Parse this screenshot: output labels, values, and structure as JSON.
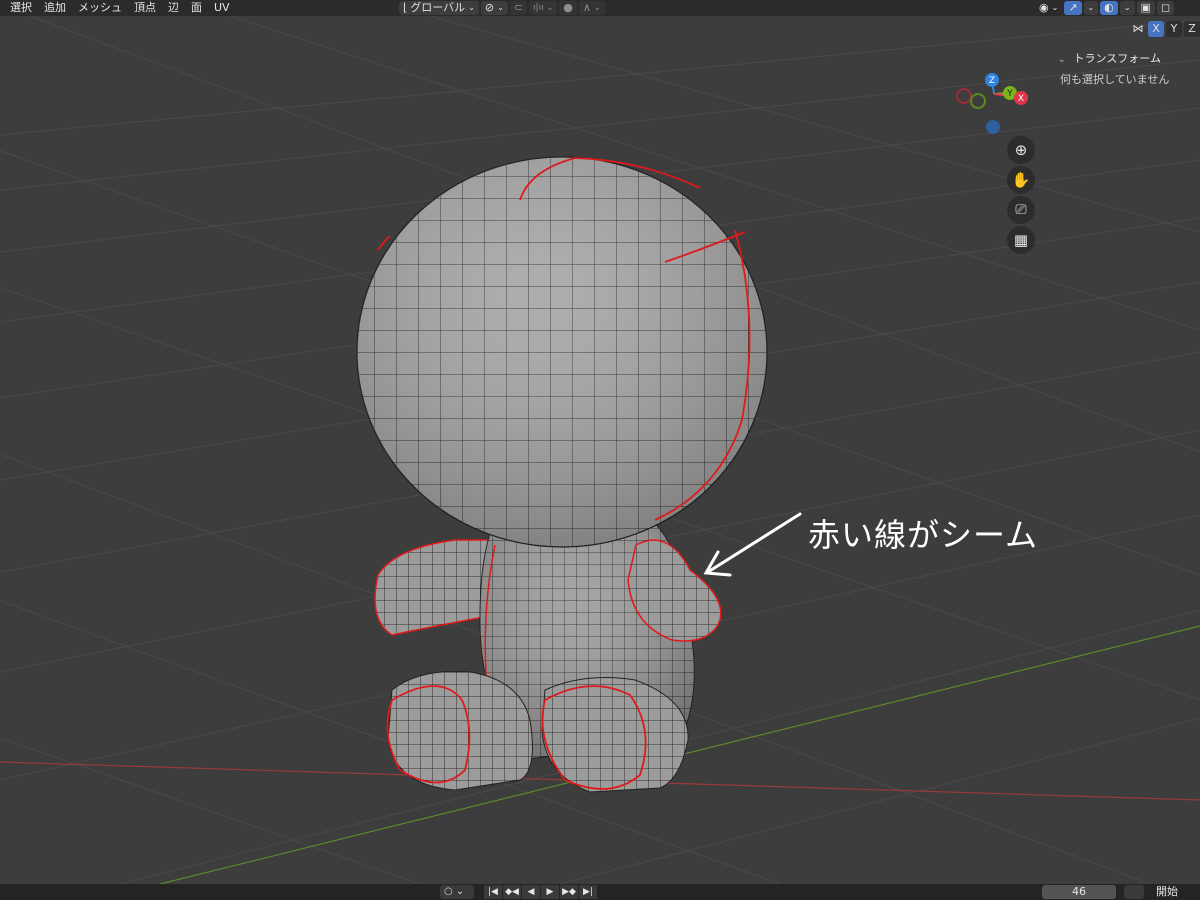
{
  "menu": {
    "items": [
      "選択",
      "追加",
      "メッシュ",
      "頂点",
      "辺",
      "面",
      "UV"
    ]
  },
  "toolbar": {
    "transform_orientation": "グローバル",
    "snap_increment_label": "ı|ıı"
  },
  "axis_toggles": [
    "X",
    "Y",
    "Z"
  ],
  "n_panel": {
    "section_title": "トランスフォーム",
    "empty_message": "何も選択していません"
  },
  "gizmo": {
    "labels": {
      "z": "Z",
      "y": "Y",
      "x": "X"
    },
    "colors": {
      "x": "#e0364a",
      "y": "#79b51b",
      "z": "#2f83e0"
    }
  },
  "annotation": {
    "text": "赤い線がシーム",
    "color": "#ffffff"
  },
  "seam_color": "#e01a1a",
  "timeline": {
    "current_frame": "46",
    "start_label": "開始"
  },
  "icons": {
    "orientation": "orientation-icon",
    "link": "link-icon",
    "snap": "magnet-icon",
    "proportional": "proportional-edit-icon",
    "visibility": "eye-icon",
    "gizmo_toggle": "gizmo-icon",
    "overlay": "overlay-icon",
    "xray": "xray-icon",
    "mirror": "butterfly-icon",
    "zoom": "zoom-icon",
    "pan": "hand-icon",
    "camera": "camera-icon",
    "perspective": "grid-icon"
  }
}
